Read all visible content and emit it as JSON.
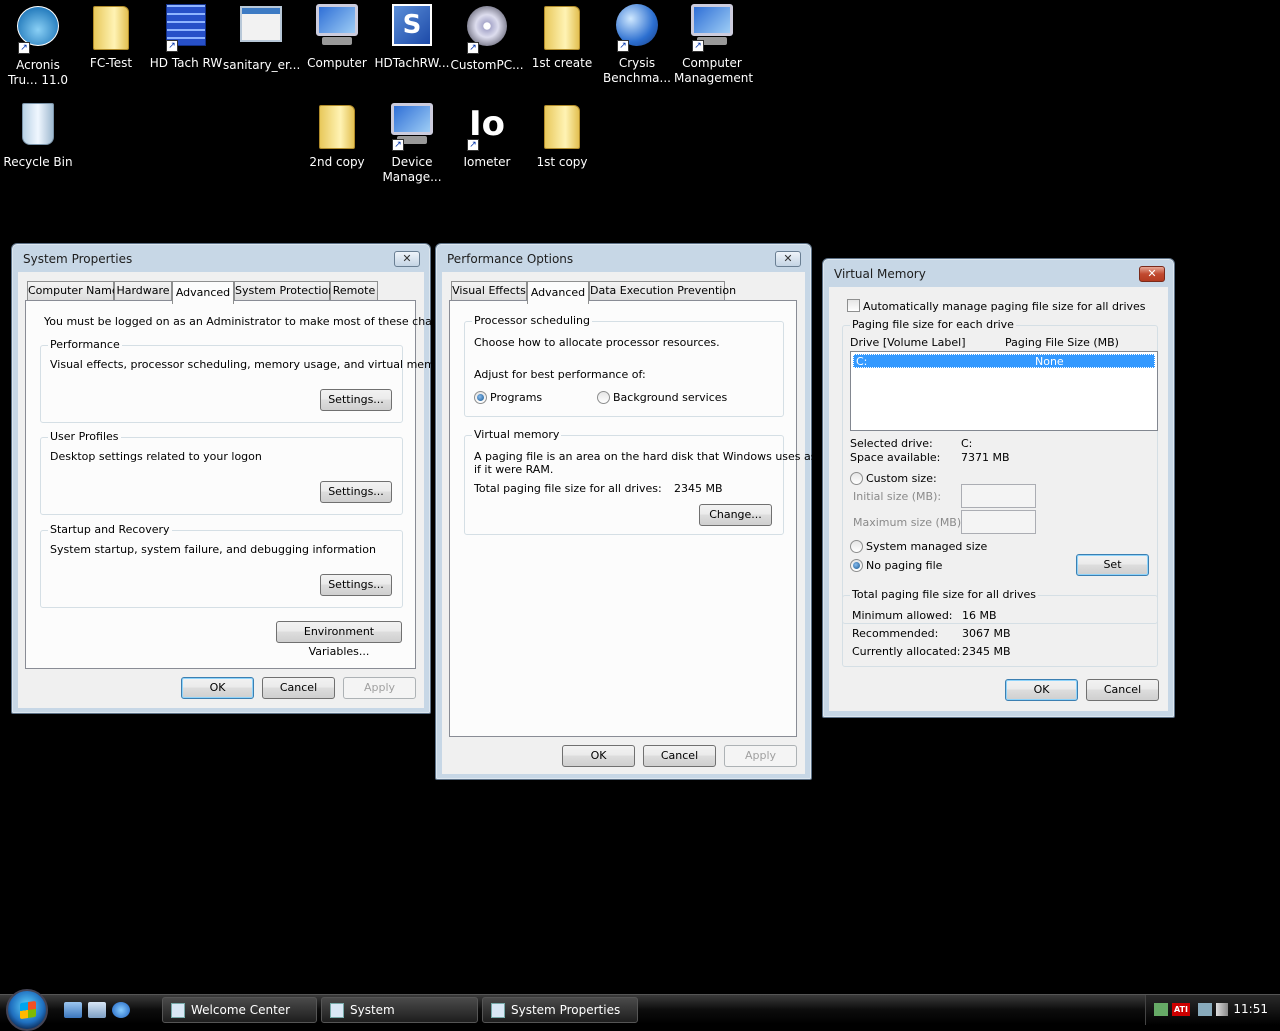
{
  "desktop": {
    "icons": [
      {
        "label": "Acronis Tru... 11.0"
      },
      {
        "label": "FC-Test"
      },
      {
        "label": "HD Tach RW"
      },
      {
        "label": "sanitary_er..."
      },
      {
        "label": "Computer"
      },
      {
        "label": "HDTachRW..."
      },
      {
        "label": "CustomPC..."
      },
      {
        "label": "1st create"
      },
      {
        "label": "Crysis Benchma..."
      },
      {
        "label": "Computer Management"
      },
      {
        "label": "Recycle Bin"
      },
      {
        "label": "2nd copy"
      },
      {
        "label": "Device Manage..."
      },
      {
        "label": "Iometer"
      },
      {
        "label": "1st copy"
      }
    ],
    "io_glyph": "Io",
    "s_glyph": "S"
  },
  "system_properties": {
    "title": "System Properties",
    "close": "✕",
    "tabs": [
      "Computer Name",
      "Hardware",
      "Advanced",
      "System Protection",
      "Remote"
    ],
    "admin_note": "You must be logged on as an Administrator to make most of these changes.",
    "performance": {
      "label": "Performance",
      "desc": "Visual effects, processor scheduling, memory usage, and virtual memory",
      "button": "Settings..."
    },
    "user_profiles": {
      "label": "User Profiles",
      "desc": "Desktop settings related to your logon",
      "button": "Settings..."
    },
    "startup": {
      "label": "Startup and Recovery",
      "desc": "System startup, system failure, and debugging information",
      "button": "Settings..."
    },
    "env_button": "Environment Variables...",
    "ok": "OK",
    "cancel": "Cancel",
    "apply": "Apply"
  },
  "performance_options": {
    "title": "Performance Options",
    "close": "✕",
    "tabs": [
      "Visual Effects",
      "Advanced",
      "Data Execution Prevention"
    ],
    "processor": {
      "label": "Processor scheduling",
      "desc": "Choose how to allocate processor resources.",
      "adjust": "Adjust for best performance of:",
      "programs": "Programs",
      "background": "Background services"
    },
    "virtual_memory": {
      "label": "Virtual memory",
      "desc1": "A paging file is an area on the hard disk that Windows uses as",
      "desc2": "if it were RAM.",
      "total_label": "Total paging file size for all drives:",
      "total_value": "2345 MB",
      "change": "Change..."
    },
    "ok": "OK",
    "cancel": "Cancel",
    "apply": "Apply"
  },
  "virtual_memory": {
    "title": "Virtual Memory",
    "close": "✕",
    "auto_manage": "Automatically manage paging file size for all drives",
    "each_drive": "Paging file size for each drive",
    "col_drive": "Drive  [Volume Label]",
    "col_size": "Paging File Size (MB)",
    "rows": [
      {
        "drive": "C:",
        "size": "None"
      }
    ],
    "selected_drive_label": "Selected drive:",
    "selected_drive_value": "C:",
    "space_label": "Space available:",
    "space_value": "7371 MB",
    "custom": "Custom size:",
    "initial": "Initial size (MB):",
    "maximum": "Maximum size (MB):",
    "system_managed": "System managed size",
    "no_paging": "No paging file",
    "set": "Set",
    "total_group": "Total paging file size for all drives",
    "min_label": "Minimum allowed:",
    "min_value": "16 MB",
    "rec_label": "Recommended:",
    "rec_value": "3067 MB",
    "cur_label": "Currently allocated:",
    "cur_value": "2345 MB",
    "ok": "OK",
    "cancel": "Cancel"
  },
  "taskbar": {
    "buttons": [
      "Welcome Center",
      "System",
      "System Properties"
    ],
    "clock": "11:51",
    "tray_ati": "ATI"
  }
}
